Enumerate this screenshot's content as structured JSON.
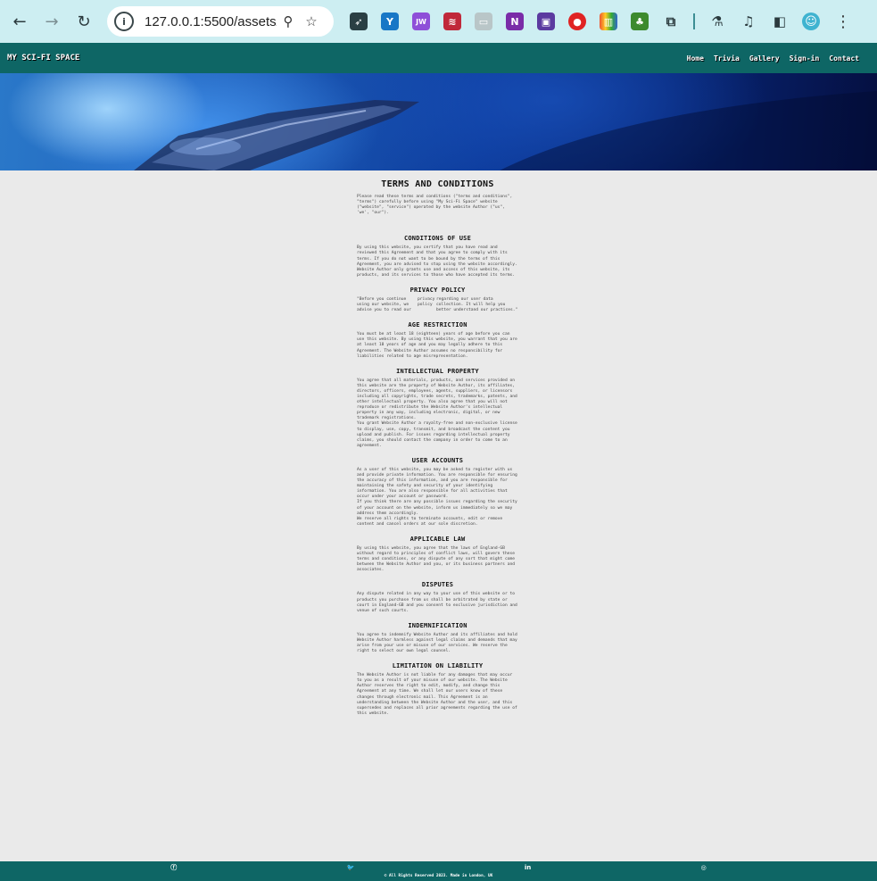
{
  "browser": {
    "url": "127.0.0.1:5500/assets/...",
    "back_icon": "←",
    "forward_icon": "→",
    "reload_icon": "↻",
    "info_icon": "i",
    "zoom_icon": "⚲",
    "star_icon": "☆",
    "menu_icon": "⋮",
    "extensions": [
      {
        "name": "rocket-extension-icon",
        "color": "#2a3f44",
        "glyph": "➶"
      },
      {
        "name": "vpn-extension-icon",
        "color": "#1877c6",
        "glyph": "Y"
      },
      {
        "name": "jw-extension-icon",
        "color": "#8e4fd8",
        "glyph": "JW"
      },
      {
        "name": "wifi-extension-icon",
        "color": "#c0283a",
        "glyph": "≋"
      },
      {
        "name": "camera-extension-icon",
        "color": "#b9c6c8",
        "glyph": "▭"
      },
      {
        "name": "onenote-extension-icon",
        "color": "#7a2ca8",
        "glyph": "N"
      },
      {
        "name": "save-extension-icon",
        "color": "#5b3aa0",
        "glyph": "▣"
      },
      {
        "name": "stop-extension-icon",
        "color": "#e02323",
        "glyph": "●"
      },
      {
        "name": "colors-extension-icon",
        "color": "#d69a24",
        "glyph": "▥"
      },
      {
        "name": "html-extension-icon",
        "color": "#3d8a2e",
        "glyph": "♣"
      },
      {
        "name": "puzzle-extension-icon",
        "color": "#2b3a3e",
        "glyph": "⧉"
      }
    ],
    "labs_icon": "⚗",
    "media_icon": "♫",
    "sidepanel_icon": "◧",
    "profile_icon": "☺"
  },
  "site": {
    "brand": "MY SCI-FI SPACE",
    "nav": [
      "Home",
      "Trivia",
      "Gallery",
      "Sign-in",
      "Contact"
    ]
  },
  "terms": {
    "title": "TERMS AND CONDITIONS",
    "intro": "Please read these terms and conditions (\"terms and conditions\", \"terms\") carefully before using \"My Sci-Fi Space\" website (\"website\", \"service\") operated by the website Author (\"us\", 'we', \"our\").",
    "conditions_heading": "CONDITIONS OF USE",
    "conditions_text": "By using this website, you certify that you have read and reviewed this Agreement and that you agree to comply with its terms. If you do not want to be bound by the terms of this Agreement, you are advised to stop using the website accordingly. Website Author only grants use and access of this website, its products, and its services to those who have accepted its terms.",
    "privacy_heading": "PRIVACY POLICY",
    "privacy_col1": "\"Before you continue using our website, we advise you to read our",
    "privacy_col2": "privacy policy",
    "privacy_col3": "regarding our user data collection. It will help you better understand our practices.\"",
    "age_heading": "AGE RESTRICTION",
    "age_text": "You must be at least 18 (eighteen) years of age before you can use this website. By using this website, you warrant that you are at least 18 years of age and you may legally adhere to this Agreement. The Website Author assumes no responsibility for liabilities related to age misrepresentation.",
    "ip_heading": "INTELLECTUAL PROPERTY",
    "ip_text1": "You agree that all materials, products, and services provided on this website are the property of Website Author, its affiliates, directors, officers, employees, agents, suppliers, or licensors including all copyrights, trade secrets, trademarks, patents, and other intellectual property. You also agree that you will not reproduce or redistribute the Website Author's intellectual property in any way, including electronic, digital, or new trademark registrations.",
    "ip_text2": "You grant Website Author a royalty-free and non-exclusive license to display, use, copy, transmit, and broadcast the content you upload and publish. For issues regarding intellectual property claims, you should contact the company in order to come to an agreement.",
    "ua_heading": "USER ACCOUNTS",
    "ua_text1": "As a user of this website, you may be asked to register with us and provide private information. You are responsible for ensuring the accuracy of this information, and you are responsible for maintaining the safety and security of your identifying information. You are also responsible for all activities that occur under your account or password.",
    "ua_text2": "If you think there are any possible issues regarding the security of your account on the website, inform us immediately so we may address them accordingly.",
    "ua_text3": "We reserve all rights to terminate accounts, edit or remove content and cancel orders at our sole discretion.",
    "law_heading": "APPLICABLE LAW",
    "law_text": "By using this website, you agree that the laws of England-GB without regard to principles of conflict laws, will govern these terms and conditions, or any dispute of any sort that might come between the Website Author and you, or its business partners and associates.",
    "disputes_heading": "DISPUTES",
    "disputes_text": "Any dispute related in any way to your use of this website or to products you purchase from us shall be arbitrated by state or court in England-GB and you consent to exclusive jurisdiction and venue of such courts.",
    "indem_heading": "INDEMNIFICATION",
    "indem_text": "You agree to indemnify Website Author and its affiliates and hold Website Author harmless against legal claims and demands that may arise from your use or misuse of our services. We reserve the right to select our own legal counsel.",
    "liab_heading": "LIMITATION ON LIABILITY",
    "liab_text": "The Website Author is not liable for any damages that may occur to you as a result of your misuse of our website. The Website Author reserves the right to edit, modify, and change this Agreement at any time. We shall let our users know of these changes through electronic mail. This Agreement is an understanding between the Website Author and the user, and this supersedes and replaces all prior agreements regarding the use of this website."
  },
  "footer": {
    "social": [
      "ⓕ",
      "🐦",
      "in",
      "◎"
    ],
    "copyright": "© All Rights Reserved 2023. Made in London, UK"
  }
}
